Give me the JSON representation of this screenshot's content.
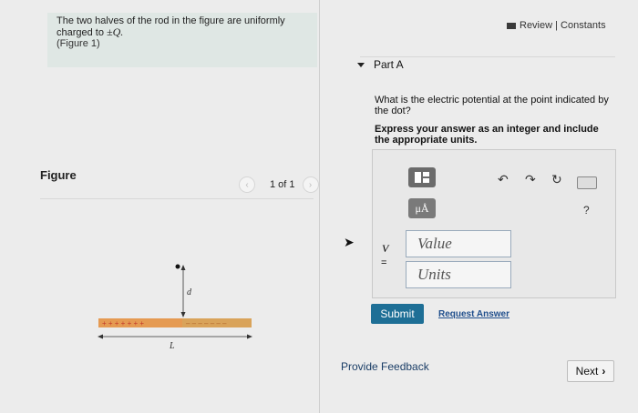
{
  "problem": {
    "line1": "The two halves of the rod in the figure are uniformly",
    "line2_prefix": "charged to ",
    "line2_charge": "±Q.",
    "figure_link": "(Figure 1)"
  },
  "header": {
    "review_constants": "Review | Constants"
  },
  "part": {
    "title": "Part A",
    "question": "What is the electric potential at the point indicated by the dot?",
    "instruction": "Express your answer as an integer and include the appropriate units."
  },
  "figure": {
    "label": "Figure",
    "pager": "1 of 1",
    "prev_icon": "‹",
    "next_icon": "›",
    "d_label": "d",
    "L_label": "L",
    "plus_signs": "+ + + + + + +",
    "minus_signs": "– – – – – – –"
  },
  "answer": {
    "micro_button": "μÅ",
    "help": "?",
    "variable": "V",
    "equals": "=",
    "value_placeholder": "Value",
    "units_placeholder": "Units"
  },
  "actions": {
    "submit": "Submit",
    "request_answer": "Request Answer",
    "provide_feedback": "Provide Feedback",
    "next": "Next"
  }
}
